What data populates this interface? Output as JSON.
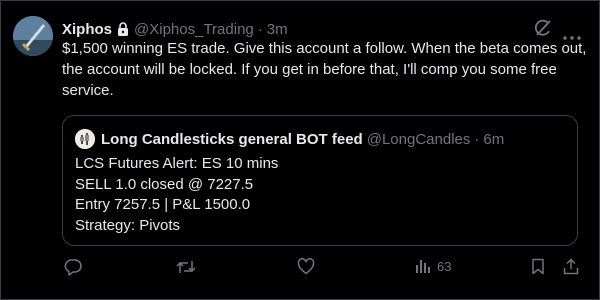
{
  "tweet": {
    "author_name": "Xiphos",
    "author_handle": "@Xiphos_Trading",
    "separator": "·",
    "time": "3m",
    "text": "$1,500 winning ES trade. Give this account a follow. When the beta comes out, the account will be locked. If you get in before that, I'll comp you some free service."
  },
  "quoted": {
    "author_name": "Long Candlesticks general BOT feed",
    "author_handle": "@LongCandles",
    "separator": "·",
    "time": "6m",
    "lines": [
      "LCS Futures Alert: ES 10 mins",
      "SELL 1.0 closed @ 7227.5",
      "Entry 7257.5 | P&L 1500.0",
      "Strategy: Pivots"
    ]
  },
  "actions": {
    "views_count": "63"
  },
  "icons": {
    "verified": "lock-icon",
    "grok": "grok-icon",
    "more": "more-icon",
    "reply": "reply-icon",
    "retweet": "retweet-icon",
    "like": "like-icon",
    "views": "views-icon",
    "bookmark": "bookmark-icon",
    "share": "share-icon"
  },
  "colors": {
    "background": "#000000",
    "text": "#e7e9ea",
    "muted": "#71767b",
    "border": "#3a3d41"
  }
}
